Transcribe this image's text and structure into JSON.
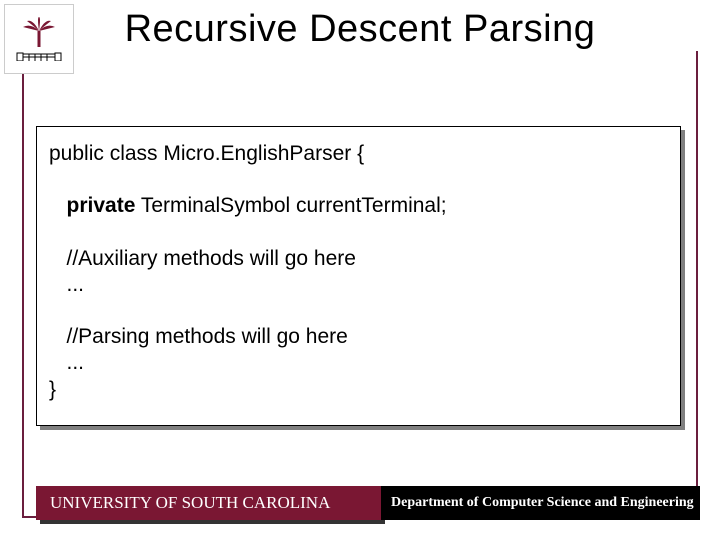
{
  "title": "Recursive Descent Parsing",
  "code": {
    "l1": "public class Micro.EnglishParser {",
    "l2_kw": "   private",
    "l2_rest": " TerminalSymbol currentTerminal;",
    "l3": "   //Auxiliary methods will go here",
    "l4": "   ...",
    "l5": "   //Parsing methods will go here",
    "l6": "   ...",
    "l7": "}"
  },
  "footer": {
    "university": "UNIVERSITY OF SOUTH CAROLINA",
    "department": "Department of Computer Science and Engineering"
  }
}
